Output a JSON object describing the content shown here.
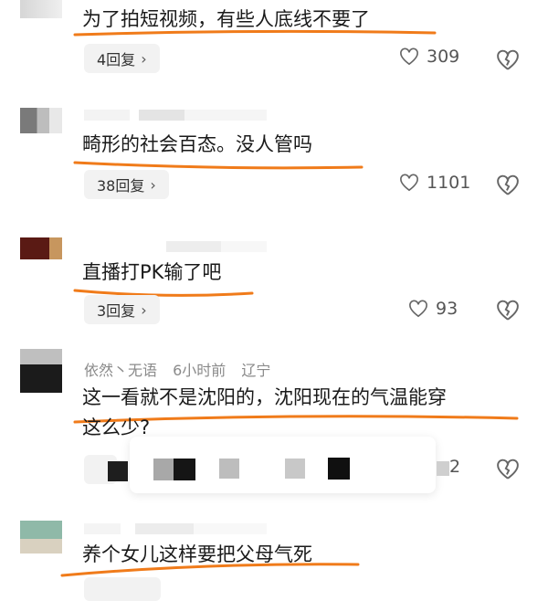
{
  "colors": {
    "underline": "#f07b1a",
    "meta": "#8a8a8a",
    "reply_bg": "#f2f2f2"
  },
  "comments": [
    {
      "text": "为了拍短视频，有些人底线不要了",
      "replies": "4回复",
      "likes": "309"
    },
    {
      "text": "畸形的社会百态。没人管吗",
      "replies": "38回复",
      "likes": "1101"
    },
    {
      "text": "直播打PK输了吧",
      "replies": "3回复",
      "likes": "93"
    },
    {
      "author": "依然丶无语",
      "time": "6小时前",
      "location": "辽宁",
      "text_line1": "这一看就不是沈阳的，沈阳现在的气温能穿",
      "text_line2": "这么少?",
      "likes": "2"
    },
    {
      "text": "养个女儿这样要把父母气死"
    }
  ],
  "icons": {
    "like": "heart-outline-icon",
    "dislike": "broken-heart-icon",
    "reply_more": "chevron-right-icon"
  }
}
